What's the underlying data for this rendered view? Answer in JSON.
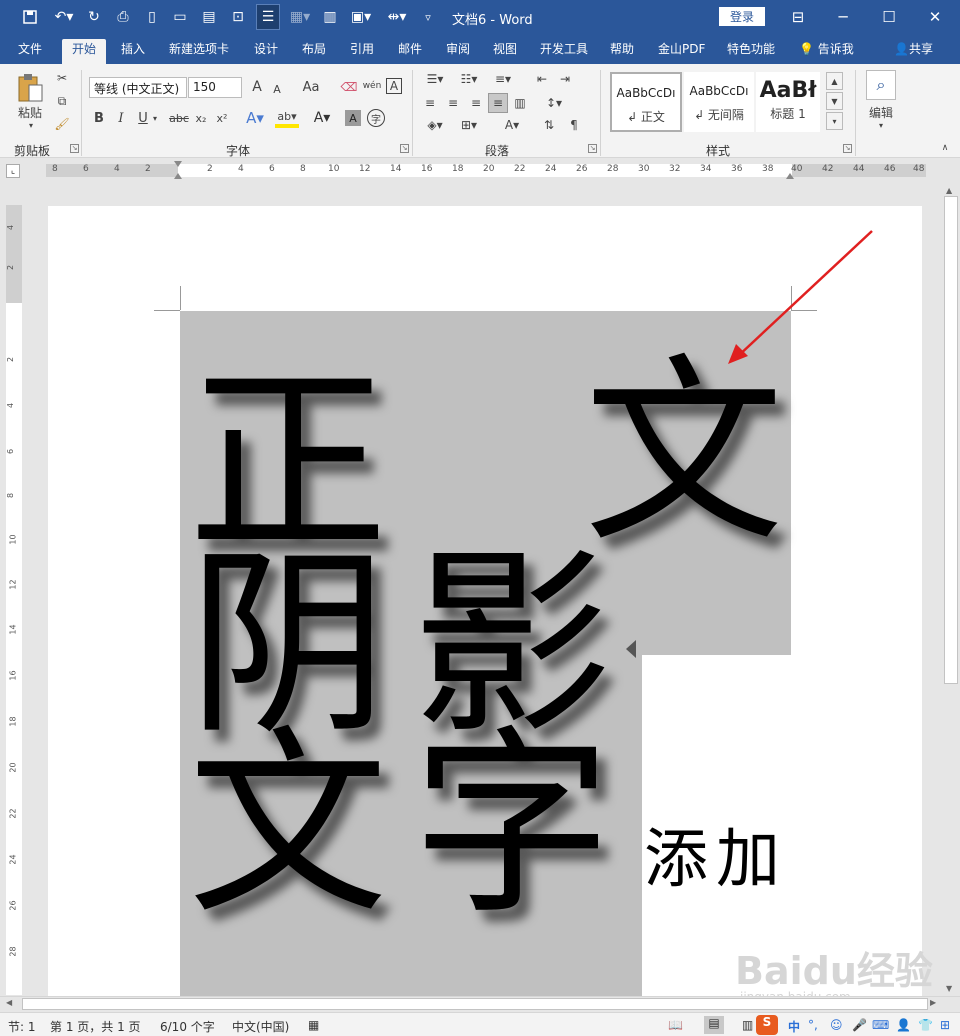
{
  "title": {
    "doc": "文档6 - Word",
    "login": "登录"
  },
  "window_controls": {
    "restore_icon": "ribbon-display-icon",
    "minimize": "─",
    "maximize": "☐",
    "close": "✕"
  },
  "quick_access": [
    "save-icon",
    "undo-icon",
    "redo-icon",
    "print-preview-icon",
    "new-doc-icon",
    "open-folder-icon",
    "paste-special-icon",
    "screenshot-icon",
    "reading-mode-icon",
    "table-icon",
    "columns-icon",
    "clipboard-icon",
    "spacing-icon",
    "customize-icon"
  ],
  "tabs": [
    "文件",
    "开始",
    "插入",
    "新建选项卡",
    "设计",
    "布局",
    "引用",
    "邮件",
    "审阅",
    "视图",
    "开发工具",
    "帮助",
    "金山PDF",
    "特色功能",
    "告诉我",
    "共享"
  ],
  "ribbon": {
    "clipboard": {
      "label": "剪贴板",
      "paste": "粘贴"
    },
    "font": {
      "label": "字体",
      "font_name": "等线 (中文正文)",
      "font_size": "150",
      "bold": "B",
      "italic": "I",
      "underline": "U",
      "strike": "abc",
      "sub": "x₂",
      "sup": "x²",
      "grow": "A",
      "shrink": "A",
      "case": "Aa",
      "phonetic": "wén",
      "border_char": "A",
      "circle_char": "字"
    },
    "paragraph": {
      "label": "段落"
    },
    "styles": {
      "label": "样式",
      "items": [
        {
          "sample": "AaBbCcDı",
          "name": "↲ 正文"
        },
        {
          "sample": "AaBbCcDı",
          "name": "↲ 无间隔"
        },
        {
          "sample": "AaBł",
          "name": "标题 1"
        }
      ]
    },
    "editing": {
      "label": "编辑"
    }
  },
  "ruler": {
    "h_numbers": [
      "8",
      "6",
      "4",
      "2",
      "2",
      "4",
      "6",
      "8",
      "10",
      "12",
      "14",
      "16",
      "18",
      "20",
      "22",
      "24",
      "26",
      "28",
      "30",
      "32",
      "34",
      "36",
      "38",
      "40",
      "42",
      "44",
      "46",
      "48"
    ],
    "v_numbers": [
      "4",
      "2",
      "2",
      "4",
      "6",
      "8",
      "10",
      "12",
      "14",
      "16",
      "18",
      "20",
      "22",
      "24",
      "26",
      "28"
    ]
  },
  "document": {
    "chars": [
      "正",
      "文",
      "阴",
      "影",
      "文",
      "字"
    ],
    "added_text": "添加"
  },
  "status": {
    "section": "节: 1",
    "pages": "第 1 页，共 1 页",
    "words": "6/10 个字",
    "language": "中文(中国)"
  },
  "watermark": {
    "main": "Baidu经验",
    "sub": "jingyan.baidu.com"
  },
  "colors": {
    "title_bar": "#2b579a",
    "ribbon": "#f3f3f3",
    "highlight_gray": "#c0c0c0",
    "arrow": "#e02020"
  }
}
